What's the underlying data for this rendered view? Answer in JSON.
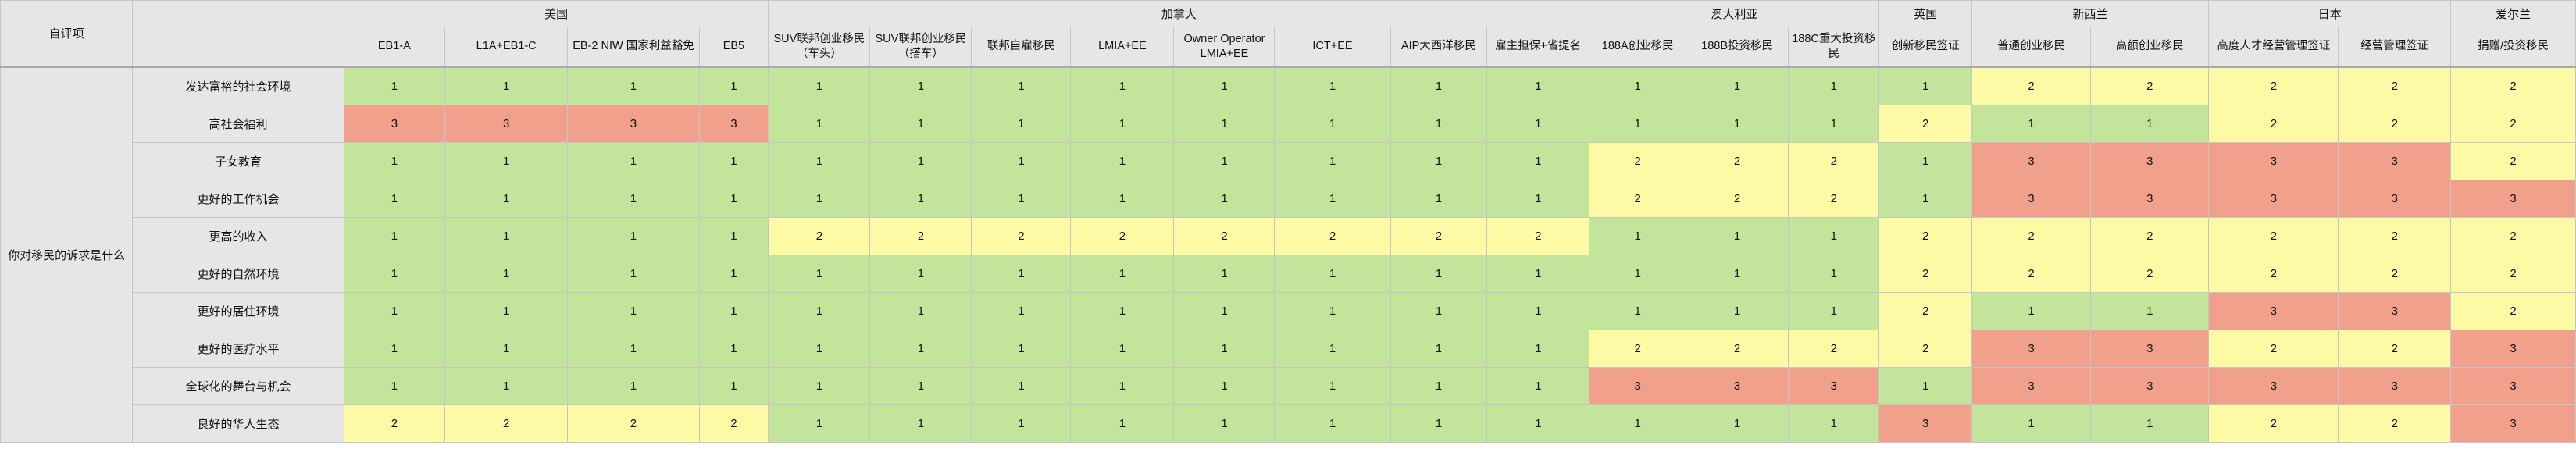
{
  "corner_label": "自评项",
  "side_label": "你对移民的诉求是什么",
  "countries": [
    {
      "name": "美国",
      "span": 4
    },
    {
      "name": "加拿大",
      "span": 8
    },
    {
      "name": "澳大利亚",
      "span": 3
    },
    {
      "name": "英国",
      "span": 1
    },
    {
      "name": "新西兰",
      "span": 2
    },
    {
      "name": "日本",
      "span": 2
    },
    {
      "name": "爱尔兰",
      "span": 1
    }
  ],
  "programs": [
    "EB1-A",
    "L1A+EB1-C",
    "EB-2 NIW 国家利益豁免",
    "EB5",
    "SUV联邦创业移民（车头）",
    "SUV联邦创业移民（搭车）",
    "联邦自雇移民",
    "LMIA+EE",
    "Owner Operator LMIA+EE",
    "ICT+EE",
    "AIP大西洋移民",
    "雇主担保+省提名",
    "188A创业移民",
    "188B投资移民",
    "188C重大投资移民",
    "创新移民签证",
    "普通创业移民",
    "高额创业移民",
    "高度人才经营管理签证",
    "经营管理签证",
    "捐赠/投资移民"
  ],
  "rows": [
    {
      "label": "发达富裕的社会环境",
      "values": [
        1,
        1,
        1,
        1,
        1,
        1,
        1,
        1,
        1,
        1,
        1,
        1,
        1,
        1,
        1,
        1,
        2,
        2,
        2,
        2,
        2
      ]
    },
    {
      "label": "高社会福利",
      "values": [
        3,
        3,
        3,
        3,
        1,
        1,
        1,
        1,
        1,
        1,
        1,
        1,
        1,
        1,
        1,
        2,
        1,
        1,
        2,
        2,
        2
      ]
    },
    {
      "label": "子女教育",
      "values": [
        1,
        1,
        1,
        1,
        1,
        1,
        1,
        1,
        1,
        1,
        1,
        1,
        2,
        2,
        2,
        1,
        3,
        3,
        3,
        3,
        2
      ]
    },
    {
      "label": "更好的工作机会",
      "values": [
        1,
        1,
        1,
        1,
        1,
        1,
        1,
        1,
        1,
        1,
        1,
        1,
        2,
        2,
        2,
        1,
        3,
        3,
        3,
        3,
        3
      ]
    },
    {
      "label": "更高的收入",
      "values": [
        1,
        1,
        1,
        1,
        2,
        2,
        2,
        2,
        2,
        2,
        2,
        2,
        1,
        1,
        1,
        2,
        2,
        2,
        2,
        2,
        2
      ]
    },
    {
      "label": "更好的自然环境",
      "values": [
        1,
        1,
        1,
        1,
        1,
        1,
        1,
        1,
        1,
        1,
        1,
        1,
        1,
        1,
        1,
        2,
        2,
        2,
        2,
        2,
        2
      ]
    },
    {
      "label": "更好的居住环境",
      "values": [
        1,
        1,
        1,
        1,
        1,
        1,
        1,
        1,
        1,
        1,
        1,
        1,
        1,
        1,
        1,
        2,
        1,
        1,
        3,
        3,
        2
      ]
    },
    {
      "label": "更好的医疗水平",
      "values": [
        1,
        1,
        1,
        1,
        1,
        1,
        1,
        1,
        1,
        1,
        1,
        1,
        2,
        2,
        2,
        2,
        3,
        3,
        2,
        2,
        3
      ]
    },
    {
      "label": "全球化的舞台与机会",
      "values": [
        1,
        1,
        1,
        1,
        1,
        1,
        1,
        1,
        1,
        1,
        1,
        1,
        3,
        3,
        3,
        1,
        3,
        3,
        3,
        3,
        3
      ]
    },
    {
      "label": "良好的华人生态",
      "values": [
        2,
        2,
        2,
        2,
        1,
        1,
        1,
        1,
        1,
        1,
        1,
        1,
        1,
        1,
        1,
        3,
        1,
        1,
        2,
        2,
        3
      ]
    }
  ],
  "colors": {
    "1": "#c3e59b",
    "2": "#fdfaa6",
    "3": "#f1a08b",
    "header": "#e6e6e6"
  }
}
